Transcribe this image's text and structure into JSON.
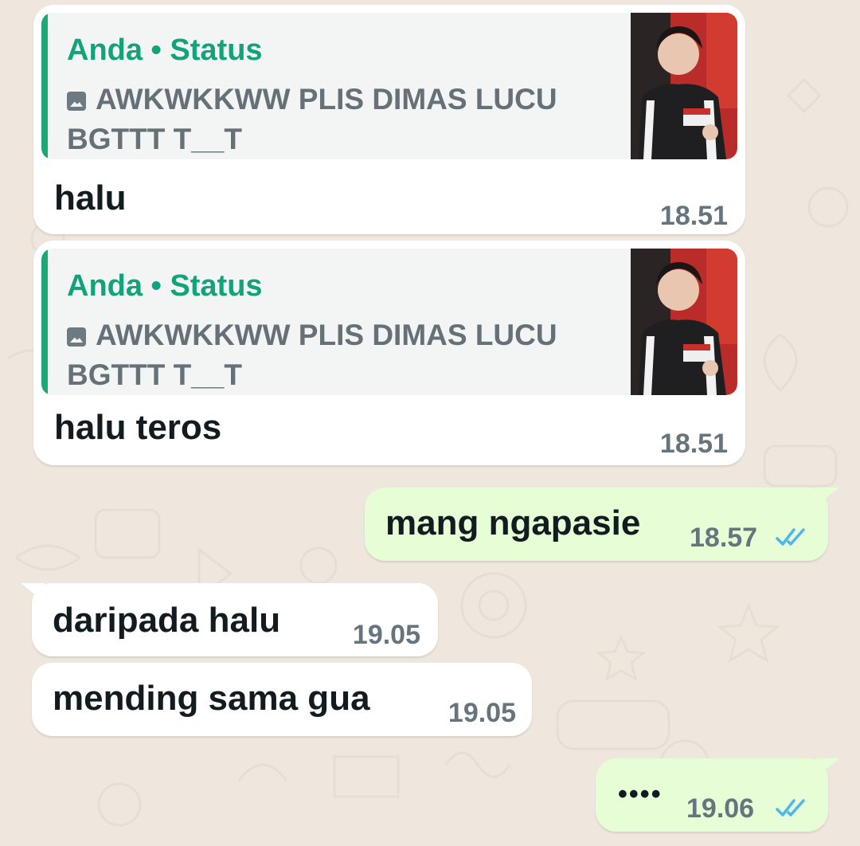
{
  "messages": [
    {
      "direction": "incoming",
      "quote": {
        "author": "Anda • Status",
        "text": "AWKWKKWW PLIS DIMAS LUCU BGTTT T__T",
        "media_icon": "image-icon"
      },
      "text": "halu",
      "time": "18.51"
    },
    {
      "direction": "incoming",
      "quote": {
        "author": "Anda • Status",
        "text": "AWKWKKWW PLIS DIMAS LUCU BGTTT T__T",
        "media_icon": "image-icon"
      },
      "text": "halu teros",
      "time": "18.51"
    },
    {
      "direction": "outgoing",
      "text": "mang ngapasie",
      "time": "18.57",
      "status_icon": "double-check-read-icon"
    },
    {
      "direction": "incoming",
      "text": "daripada halu",
      "time": "19.05"
    },
    {
      "direction": "incoming",
      "text": "mending sama gua",
      "time": "19.05"
    },
    {
      "direction": "outgoing",
      "text": "••••",
      "time": "19.06",
      "status_icon": "double-check-read-icon"
    }
  ],
  "colors": {
    "wallpaper": "#efe7dd",
    "incoming_bubble": "#ffffff",
    "outgoing_bubble": "#e7fdd6",
    "quote_accent": "#1aa875",
    "read_ticks": "#4fb6ec"
  }
}
